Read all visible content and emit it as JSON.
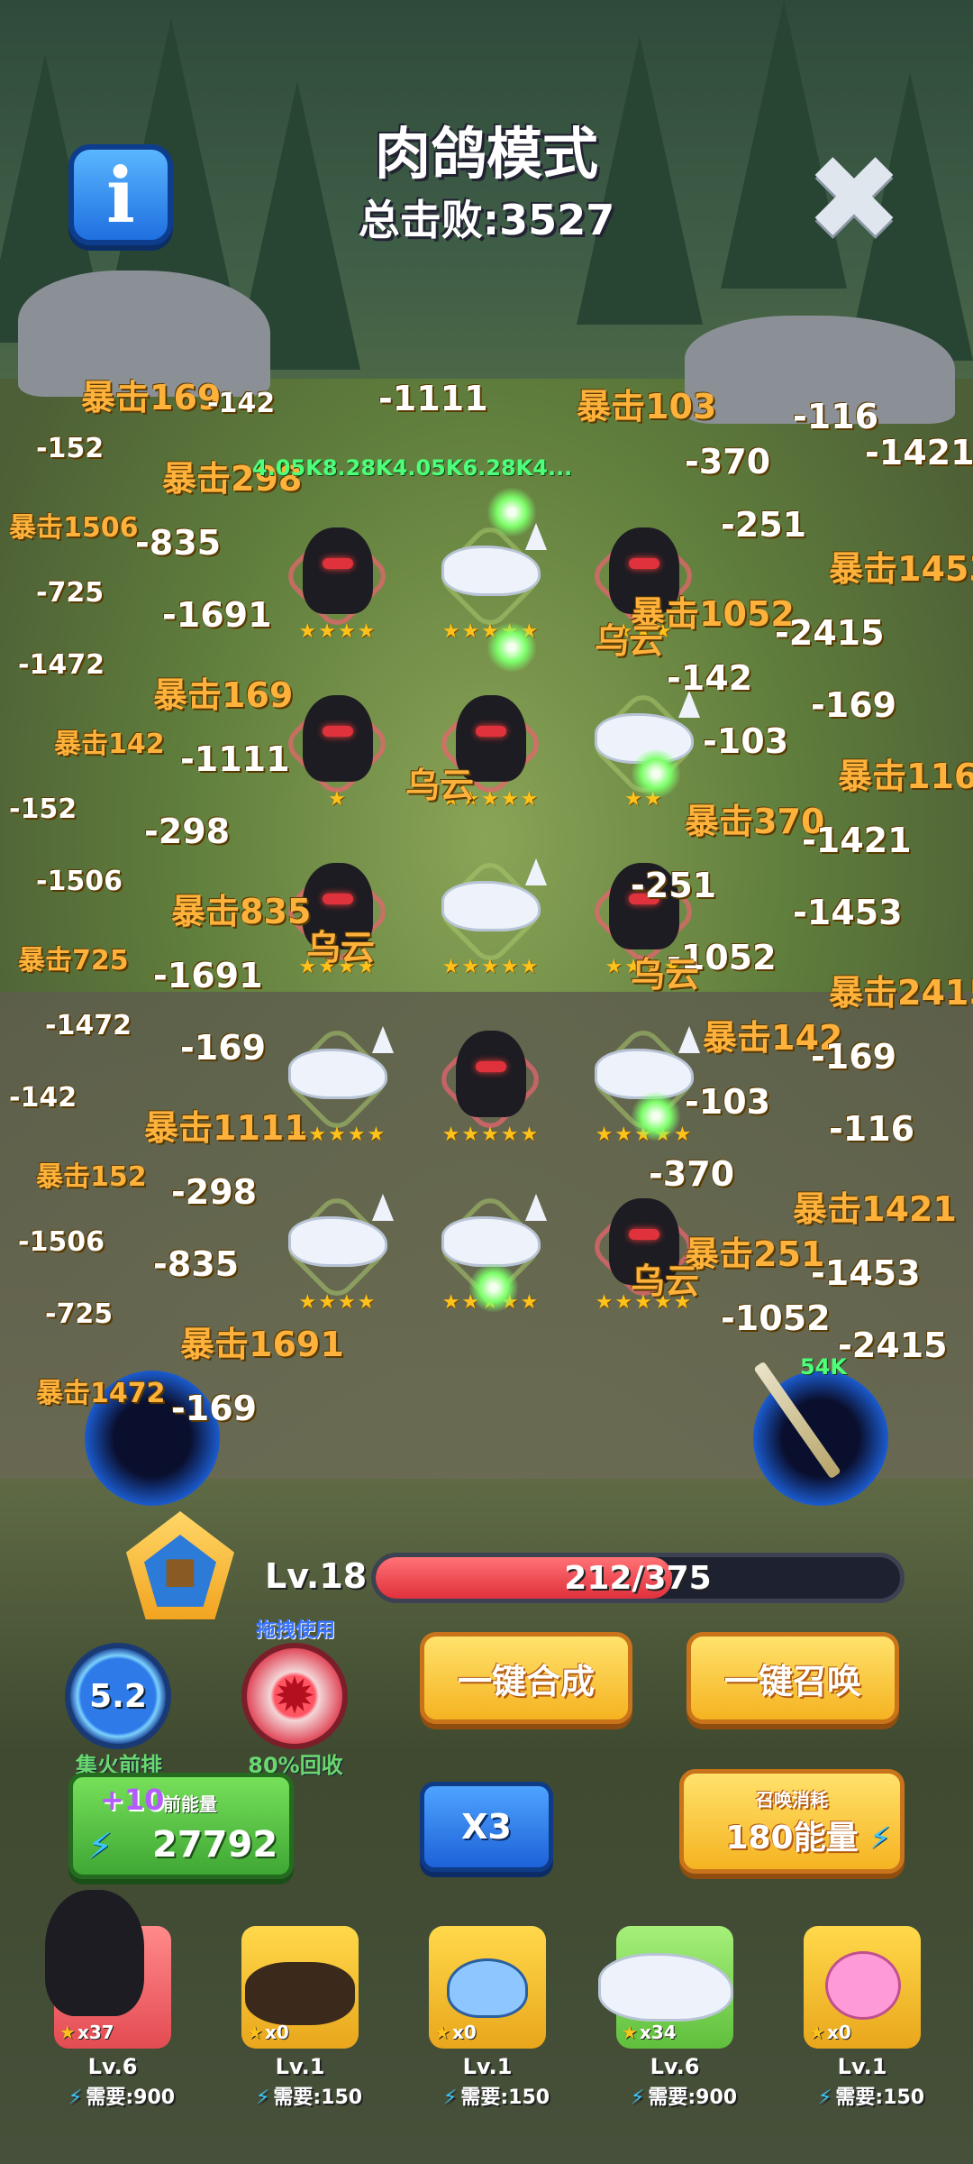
{
  "header": {
    "title": "肉鸽模式",
    "total_kills": "总击败:3527"
  },
  "floating_text": {
    "green_damage": "4.05K8.28K4.05K6.28K4...",
    "portal_damage": "54K",
    "crit": "暴击",
    "buff": "乌云",
    "numbers": [
      "-169",
      "-142",
      "-1111",
      "-103",
      "-116",
      "-152",
      "-298",
      "-370",
      "-1421",
      "-1506",
      "-835",
      "-251",
      "-1453",
      "-725",
      "-1691",
      "-1052",
      "-2415",
      "-1472",
      "-169",
      "-142"
    ]
  },
  "board": {
    "rows": [
      [
        {
          "unit": "reaper",
          "stars": "★★★★",
          "slot": "red"
        },
        {
          "unit": "wolf",
          "stars": "★★★★★",
          "slot": "green"
        },
        {
          "unit": "reaper",
          "stars": "★★★",
          "slot": "red"
        }
      ],
      [
        {
          "unit": "reaper",
          "stars": "★",
          "slot": "red"
        },
        {
          "unit": "reaper",
          "stars": "★★★★★",
          "slot": "red"
        },
        {
          "unit": "wolf",
          "stars": "★★",
          "slot": "green"
        }
      ],
      [
        {
          "unit": "reaper",
          "stars": "★★★★",
          "slot": "red"
        },
        {
          "unit": "wolf",
          "stars": "★★★★★",
          "slot": "green"
        },
        {
          "unit": "reaper",
          "stars": "★★★★",
          "slot": "red"
        }
      ],
      [
        {
          "unit": "wolf",
          "stars": "★★★★★",
          "slot": "green"
        },
        {
          "unit": "reaper",
          "stars": "★★★★★",
          "slot": "red"
        },
        {
          "unit": "wolf",
          "stars": "★★★★★",
          "slot": "green"
        }
      ],
      [
        {
          "unit": "wolf",
          "stars": "★★★★",
          "slot": "green"
        },
        {
          "unit": "wolf",
          "stars": "★★★★★",
          "slot": "green"
        },
        {
          "unit": "reaper",
          "stars": "★★★★★",
          "slot": "red"
        }
      ]
    ]
  },
  "level": {
    "label": "Lv.18",
    "current": 212,
    "max": 375,
    "text": "212/375"
  },
  "skills": {
    "focus": {
      "value": "5.2",
      "label": "集火前排"
    },
    "recycle": {
      "hint": "拖拽使用",
      "label": "80%回收"
    }
  },
  "actions": {
    "merge": "一键合成",
    "summon_all": "一键召唤",
    "speed": "X3",
    "summon_cost_label": "召唤消耗",
    "summon_cost_value": "180能量"
  },
  "energy": {
    "bonus": "+10",
    "label": "前能量",
    "value": "27792"
  },
  "cards": [
    {
      "name": "reaper",
      "count": "x37",
      "level": "Lv.6",
      "need": "需要:900",
      "color": "#ff6b6b"
    },
    {
      "name": "boar",
      "count": "x0",
      "level": "Lv.1",
      "need": "需要:150",
      "color": "#ffd94a"
    },
    {
      "name": "slime",
      "count": "x0",
      "level": "Lv.1",
      "need": "需要:150",
      "color": "#ffd94a"
    },
    {
      "name": "wolf",
      "count": "x34",
      "level": "Lv.6",
      "need": "需要:900",
      "color": "#8ee05a"
    },
    {
      "name": "pink-bat",
      "count": "x0",
      "level": "Lv.1",
      "need": "需要:150",
      "color": "#ffd94a"
    }
  ],
  "icons": {
    "info": "info-icon",
    "close": "close-icon",
    "energy": "lightning-icon",
    "star": "star-icon"
  }
}
